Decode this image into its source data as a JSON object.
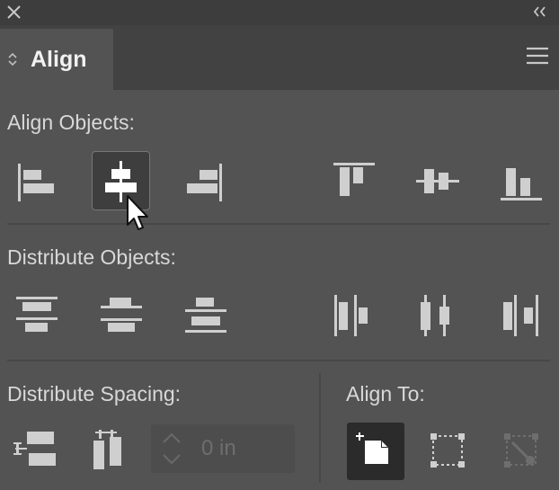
{
  "panel": {
    "tab_label": "Align"
  },
  "sections": {
    "align_objects": "Align Objects:",
    "distribute_objects": "Distribute Objects:",
    "distribute_spacing": "Distribute Spacing:",
    "align_to": "Align To:"
  },
  "spacing_field": {
    "value": "0 in"
  },
  "icons": {
    "align_objects": [
      "horizontal-align-left-icon",
      "horizontal-align-center-icon",
      "horizontal-align-right-icon",
      "vertical-align-top-icon",
      "vertical-align-center-icon",
      "vertical-align-bottom-icon"
    ],
    "distribute_objects": [
      "vertical-distribute-top-icon",
      "vertical-distribute-center-icon",
      "vertical-distribute-bottom-icon",
      "horizontal-distribute-left-icon",
      "horizontal-distribute-center-icon",
      "horizontal-distribute-right-icon"
    ],
    "distribute_spacing": [
      "vertical-distribute-space-icon",
      "horizontal-distribute-space-icon"
    ],
    "align_to": [
      "align-to-selection-icon",
      "align-to-key-object-icon",
      "align-to-artboard-icon"
    ]
  },
  "colors": {
    "panel_bg": "#535353",
    "titlebar_bg": "#3d3d3d",
    "tabstrip_bg": "#424242",
    "icon_fill": "#cfcfcf",
    "icon_active": "#ffffff",
    "selected_bg": "#2b2b2b"
  },
  "state": {
    "hovered_button": "horizontal-align-center",
    "align_to_selected": "align-to-selection"
  }
}
